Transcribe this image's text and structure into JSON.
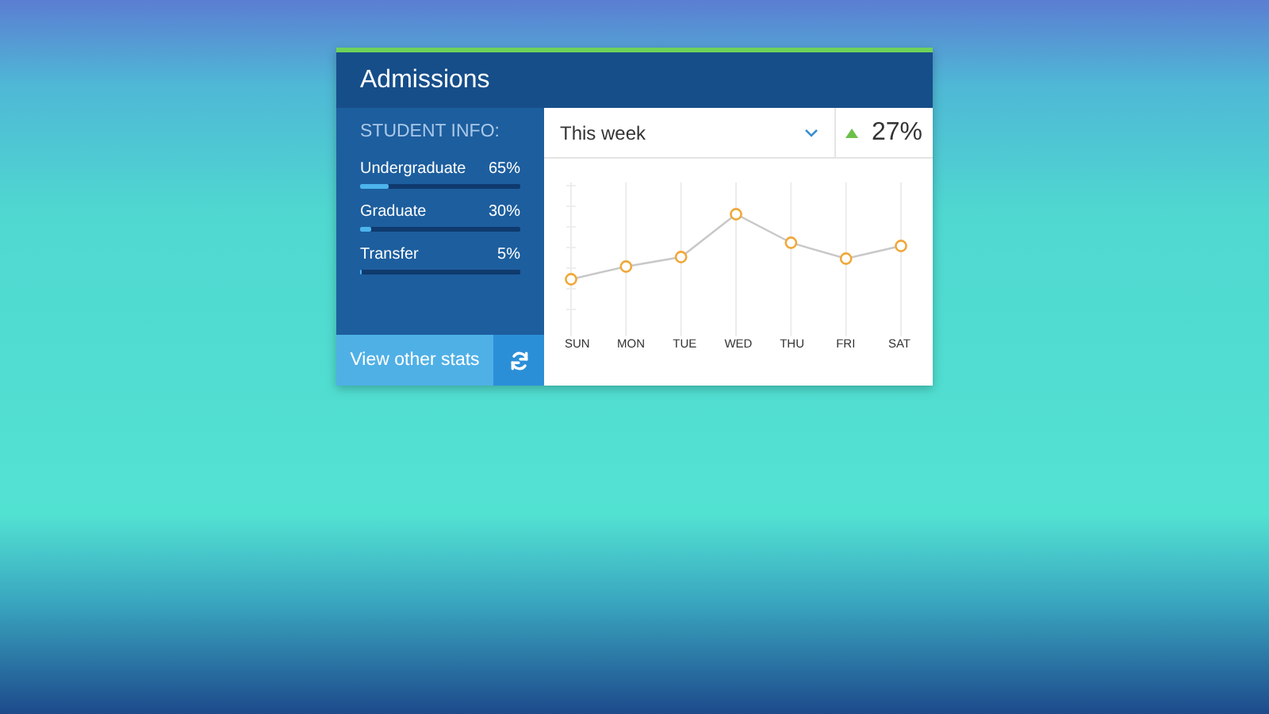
{
  "card": {
    "title": "Admissions"
  },
  "student_info": {
    "heading": "STUDENT INFO:",
    "items": [
      {
        "label": "Undergraduate",
        "value": "65%",
        "level": 0.18
      },
      {
        "label": "Graduate",
        "value": "30%",
        "level": 0.07
      },
      {
        "label": "Transfer",
        "value": "5%",
        "level": 0.01
      }
    ]
  },
  "button": {
    "label": "View other stats"
  },
  "period": {
    "value": "This week"
  },
  "change": {
    "value": "27%"
  },
  "chart": {
    "days": [
      "SUN",
      "MON",
      "TUE",
      "WED",
      "THU",
      "FRI",
      "SAT"
    ]
  }
}
